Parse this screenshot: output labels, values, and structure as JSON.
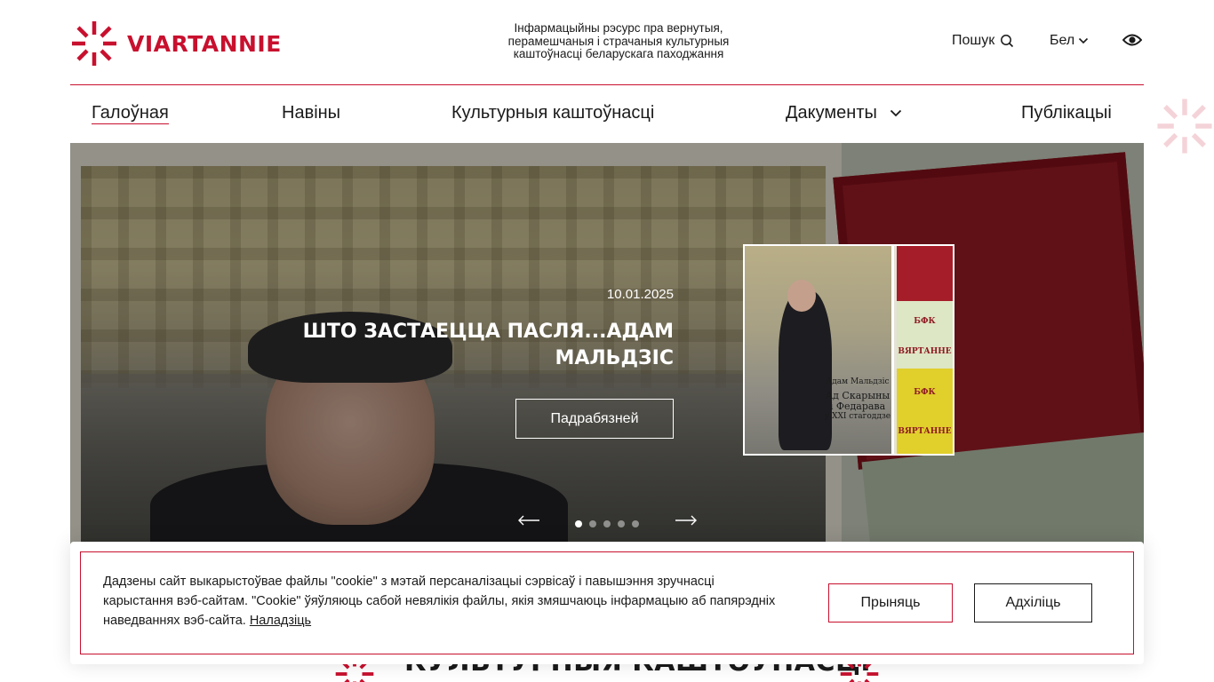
{
  "header": {
    "logo_text": "VIARTANNIE",
    "tagline_lines": [
      "Інфармацыйны рэсурс пра вернутыя,",
      "перамешчаныя і страчаныя культурныя",
      "каштоўнасці беларускага паходжання"
    ],
    "search_label": "Пошук",
    "search_icon": "search-icon",
    "lang_label": "Бел",
    "accessibility_icon": "eye-icon",
    "brand_color": "#c8102e"
  },
  "nav": {
    "items": [
      {
        "label": "Галоўная",
        "active": true
      },
      {
        "label": "Навіны"
      },
      {
        "label": "Культурныя каштоўнасці"
      },
      {
        "label": "Дакументы",
        "has_dropdown": true
      },
      {
        "label": "Публікацыі"
      }
    ]
  },
  "hero": {
    "date": "10.01.2025",
    "title": "ШТО ЗАСТАЕЦЦА ПАСЛЯ...АДАМ МАЛЬДЗІС",
    "button_label": "Падрабязней",
    "thumb_caption_author": "Адам Мальдзіс",
    "thumb_caption_title": "Ад Скарыны і Федарава",
    "thumb_caption_sub": "у XXI стагоддзе",
    "cover_labels": [
      "БФК",
      "ВЯРТАННЕ",
      "БФК",
      "ВЯРТАННЕ"
    ],
    "slides_total": 5,
    "active_slide": 1
  },
  "section": {
    "title": "КУЛЬТУРНЫЯ КАШТОЎНАСЦІ"
  },
  "cookie": {
    "text": "Дадзены сайт выкарыстоўвае файлы \"cookie\" з мэтай персаналізацыі сэрвісаў і павышэння зручнасці карыстання вэб-сайтам. \"Cookie\" ўяўляюць сабой невялікія файлы, якія змяшчаюць інфармацыю аб папярэдніх наведваннях вэб-сайта. ",
    "settings_link": "Наладзіць",
    "accept_label": "Прыняць",
    "reject_label": "Адхіліць"
  }
}
